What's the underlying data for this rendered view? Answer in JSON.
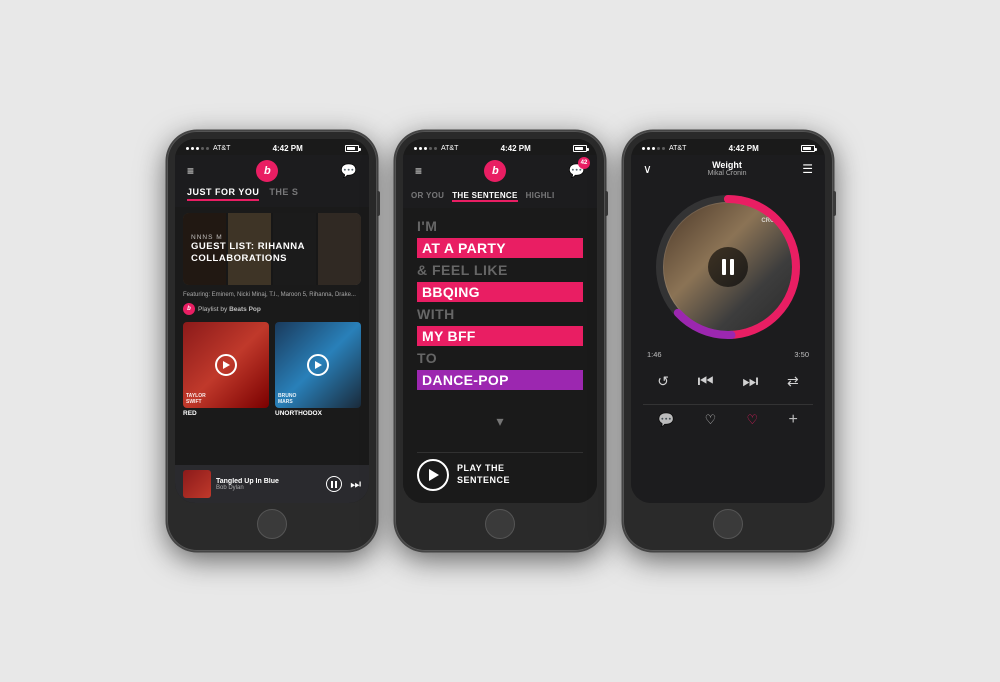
{
  "background": "#e8e8e8",
  "phone1": {
    "status": {
      "carrier": "AT&T",
      "time": "4:42 PM"
    },
    "nav": {
      "logo_label": "b",
      "menu_icon": "≡",
      "chat_icon": "💬"
    },
    "tabs": [
      "JUST FOR YOU",
      "THE S"
    ],
    "active_tab": "JUST FOR YOU",
    "guest_card": {
      "label": "NNNS M",
      "title": "GUEST LIST: RIHANNA COLLABORATIONS"
    },
    "description": "Featuring: Eminem, Nicki Minaj, T.I., Maroon 5, Rihanna, Drake...",
    "playlist_label": "Playlist by",
    "playlist_name": "Beats Pop",
    "albums": [
      {
        "title": "RED",
        "artist": "TAYLOR SWIFT",
        "style": "red"
      },
      {
        "title": "UNORTHODOX",
        "style": "blue",
        "label": "BRUNO MARS"
      }
    ],
    "now_playing": {
      "title": "Tangled Up In Blue",
      "artist": "Bob Dylan"
    }
  },
  "phone2": {
    "status": {
      "carrier": "AT&T",
      "time": "4:42 PM"
    },
    "nav": {
      "logo_label": "b",
      "menu_icon": "≡",
      "badge": "42"
    },
    "tabs": [
      "OR YOU",
      "THE SENTENCE",
      "HIGHLI"
    ],
    "active_tab": "THE SENTENCE",
    "sentence_lines": [
      {
        "text": "I'M",
        "type": "plain"
      },
      {
        "text": "AT A PARTY",
        "type": "highlighted",
        "color": "pink"
      },
      {
        "text": "& FEEL LIKE",
        "type": "plain"
      },
      {
        "text": "BBQING",
        "type": "highlighted",
        "color": "pink"
      },
      {
        "text": "WITH",
        "type": "plain"
      },
      {
        "text": "MY BFF",
        "type": "highlighted",
        "color": "pink"
      },
      {
        "text": "TO",
        "type": "plain"
      },
      {
        "text": "DANCE-POP",
        "type": "highlighted",
        "color": "magenta"
      }
    ],
    "play_button": {
      "label_line1": "PLAY THE",
      "label_line2": "SENTENCE"
    }
  },
  "phone3": {
    "status": {
      "carrier": "AT&T",
      "time": "4:42 PM"
    },
    "player": {
      "song_title": "Weight",
      "artist": "Mikal Cronin",
      "time_current": "1:46",
      "time_total": "3:50",
      "progress": 0.47
    },
    "controls": {
      "repeat": "↺",
      "prev": "⏮",
      "next": "⏭",
      "shuffle": "⇄"
    },
    "actions": {
      "chat": "💬",
      "heart": "♡",
      "heart_beats": "♡",
      "add": "+"
    }
  }
}
